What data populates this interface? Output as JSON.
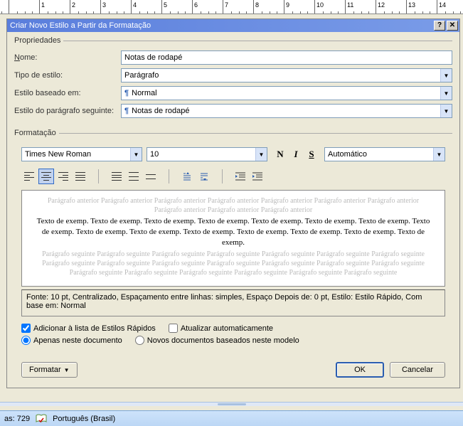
{
  "ruler": {
    "numbers": [
      "1",
      "",
      "1",
      "2",
      "3",
      "4",
      "5",
      "6",
      "7",
      "8",
      "9",
      "10",
      "11",
      "12",
      "13",
      "14"
    ]
  },
  "dialog": {
    "title": "Criar Novo Estilo a Partir da Formatação",
    "fieldsets": {
      "props": "Propriedades",
      "fmt": "Formatação"
    },
    "labels": {
      "name": "Nome:",
      "styleType": "Tipo de estilo:",
      "basedOn": "Estilo baseado em:",
      "nextPara": "Estilo do parágrafo seguinte:"
    },
    "values": {
      "name": "Notas de rodapé",
      "styleType": "Parágrafo",
      "basedOn": "Normal",
      "nextPara": "Notas de rodapé"
    },
    "font": {
      "name": "Times New Roman",
      "size": "10",
      "autoColor": "Automático"
    },
    "preview": {
      "before": "Parágrafo anterior Parágrafo anterior Parágrafo anterior Parágrafo anterior Parágrafo anterior Parágrafo anterior Parágrafo anterior Parágrafo anterior Parágrafo anterior Parágrafo anterior",
      "sample": "Texto de exemp. Texto de exemp. Texto de exemp. Texto de exemp. Texto de exemp. Texto de exemp. Texto de exemp. Texto de exemp. Texto de exemp. Texto de exemp. Texto de exemp. Texto de exemp. Texto de exemp. Texto de exemp. Texto de exemp.",
      "after": "Parágrafo seguinte Parágrafo seguinte Parágrafo seguinte Parágrafo seguinte Parágrafo seguinte Parágrafo seguinte Parágrafo seguinte Parágrafo seguinte Parágrafo seguinte Parágrafo seguinte Parágrafo seguinte Parágrafo seguinte Parágrafo seguinte Parágrafo seguinte Parágrafo seguinte Parágrafo seguinte Parágrafo seguinte Parágrafo seguinte Parágrafo seguinte Parágrafo seguinte"
    },
    "description": "Fonte: 10 pt, Centralizado, Espaçamento entre linhas:  simples, Espaço Depois de:  0 pt, Estilo: Estilo Rápido, Com base em: Normal",
    "checks": {
      "addQuick": "Adicionar à lista de Estilos Rápidos",
      "autoUpdate": "Atualizar automaticamente",
      "thisDoc": "Apenas neste documento",
      "newDocs": "Novos documentos baseados neste modelo"
    },
    "buttons": {
      "format": "Formatar",
      "ok": "OK",
      "cancel": "Cancelar"
    }
  },
  "status": {
    "words": "as: 729",
    "lang": "Português (Brasil)"
  }
}
